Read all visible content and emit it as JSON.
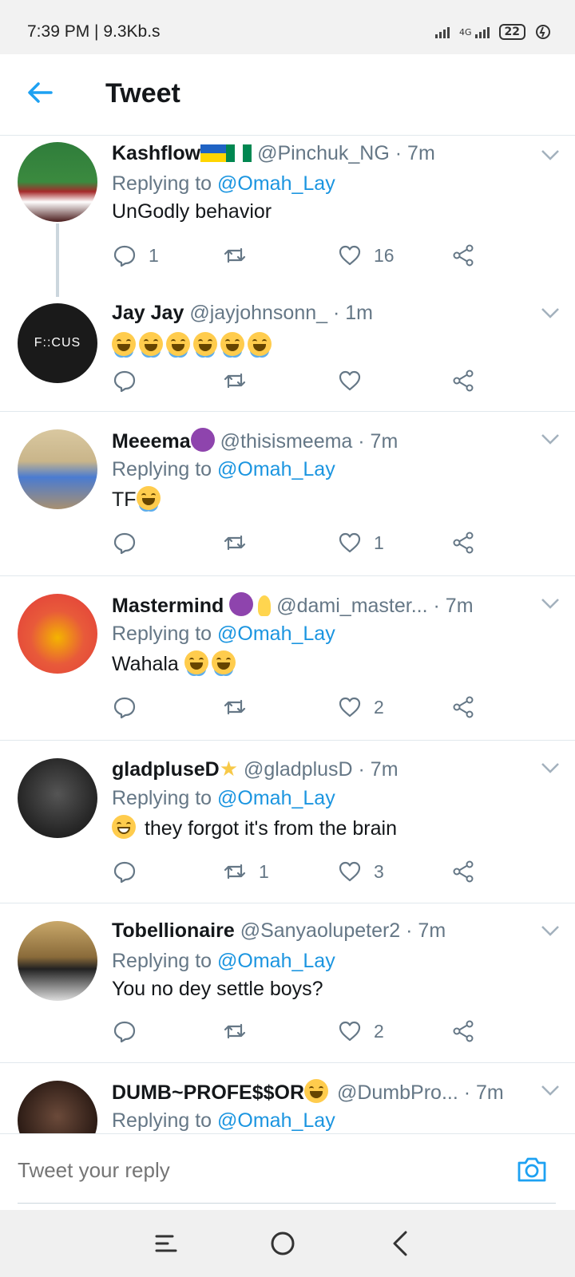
{
  "status_bar": {
    "time": "7:39 PM | 9.3Kb.s",
    "network": "4G",
    "battery": "22"
  },
  "header": {
    "title": "Tweet"
  },
  "tweets": [
    {
      "name": "Kashflow",
      "handle": "@Pinchuk_NG",
      "time": "· 7m",
      "replying_label": "Replying to",
      "replying_to": "@Omah_Lay",
      "text": "UnGodly behavior",
      "replies": "1",
      "retweets": "",
      "likes": "16"
    },
    {
      "name": "Jay Jay",
      "handle": "@jayjohnsonn_",
      "time": "· 1m",
      "replying_label": "",
      "replying_to": "",
      "text": "",
      "avatar_text": "F::CUS",
      "replies": "",
      "retweets": "",
      "likes": ""
    },
    {
      "name": "Meeema",
      "handle": "@thisismeema",
      "time": "· 7m",
      "replying_label": "Replying to",
      "replying_to": "@Omah_Lay",
      "text": "TF",
      "replies": "",
      "retweets": "",
      "likes": "1"
    },
    {
      "name": "Mastermind",
      "handle": "@dami_master...",
      "time": "· 7m",
      "replying_label": "Replying to",
      "replying_to": "@Omah_Lay",
      "text": "Wahala",
      "replies": "",
      "retweets": "",
      "likes": "2"
    },
    {
      "name": "gladpluseD",
      "handle": "@gladplusD",
      "time": "· 7m",
      "replying_label": "Replying to",
      "replying_to": "@Omah_Lay",
      "text": "they forgot it's from the brain",
      "replies": "",
      "retweets": "1",
      "likes": "3"
    },
    {
      "name": "Tobellionaire",
      "handle": "@Sanyaolupeter2",
      "time": "· 7m",
      "replying_label": "Replying to",
      "replying_to": "@Omah_Lay",
      "text": "You no dey settle boys?",
      "replies": "",
      "retweets": "",
      "likes": "2"
    },
    {
      "name": "DUMB~PROFE$$OR",
      "handle": "@DumbPro...",
      "time": "· 7m",
      "replying_label": "Replying to",
      "replying_to": "@Omah_Lay",
      "text": "",
      "replies": "",
      "retweets": "",
      "likes": ""
    }
  ],
  "reply_bar": {
    "placeholder": "Tweet your reply"
  },
  "colors": {
    "accent": "#1b95e0",
    "secondary_text": "#657786",
    "divider": "#e1e8ed"
  }
}
